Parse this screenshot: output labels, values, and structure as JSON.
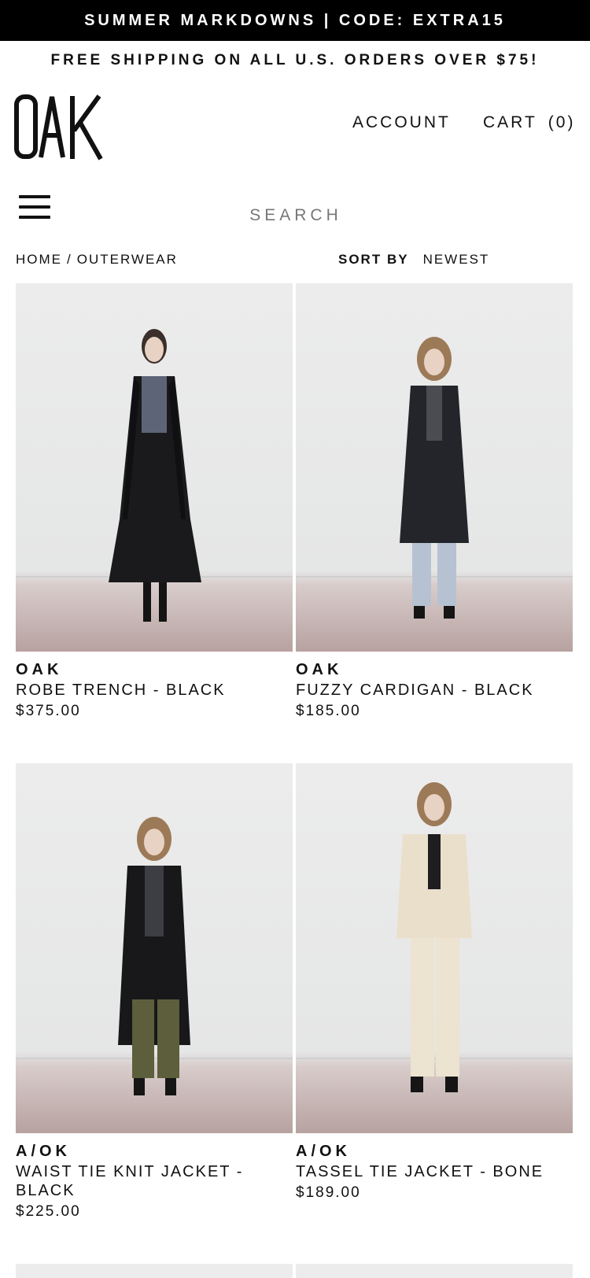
{
  "promo": {
    "text": "SUMMER MARKDOWNS | CODE: EXTRA15"
  },
  "shipping": {
    "text": "FREE SHIPPING ON ALL U.S. ORDERS OVER $75!"
  },
  "header": {
    "logo_text": "OAK",
    "account_label": "ACCOUNT",
    "cart_label": "CART",
    "cart_count": "(0)"
  },
  "search": {
    "placeholder": "SEARCH"
  },
  "breadcrumb": {
    "home": "HOME",
    "separator": "/",
    "current": "OUTERWEAR"
  },
  "sort": {
    "label": "SORT BY",
    "value": "NEWEST"
  },
  "products": [
    {
      "brand": "OAK",
      "title": "ROBE TRENCH - BLACK",
      "price": "$375.00"
    },
    {
      "brand": "OAK",
      "title": "FUZZY CARDIGAN - BLACK",
      "price": "$185.00"
    },
    {
      "brand": "A/OK",
      "title": "WAIST TIE KNIT JACKET - BLACK",
      "price": "$225.00"
    },
    {
      "brand": "A/OK",
      "title": "TASSEL TIE JACKET - BONE",
      "price": "$189.00"
    }
  ],
  "colors": {
    "promo_bg": "#000000",
    "text": "#111111",
    "muted": "#777777"
  },
  "icons": {
    "menu": "hamburger-icon"
  }
}
